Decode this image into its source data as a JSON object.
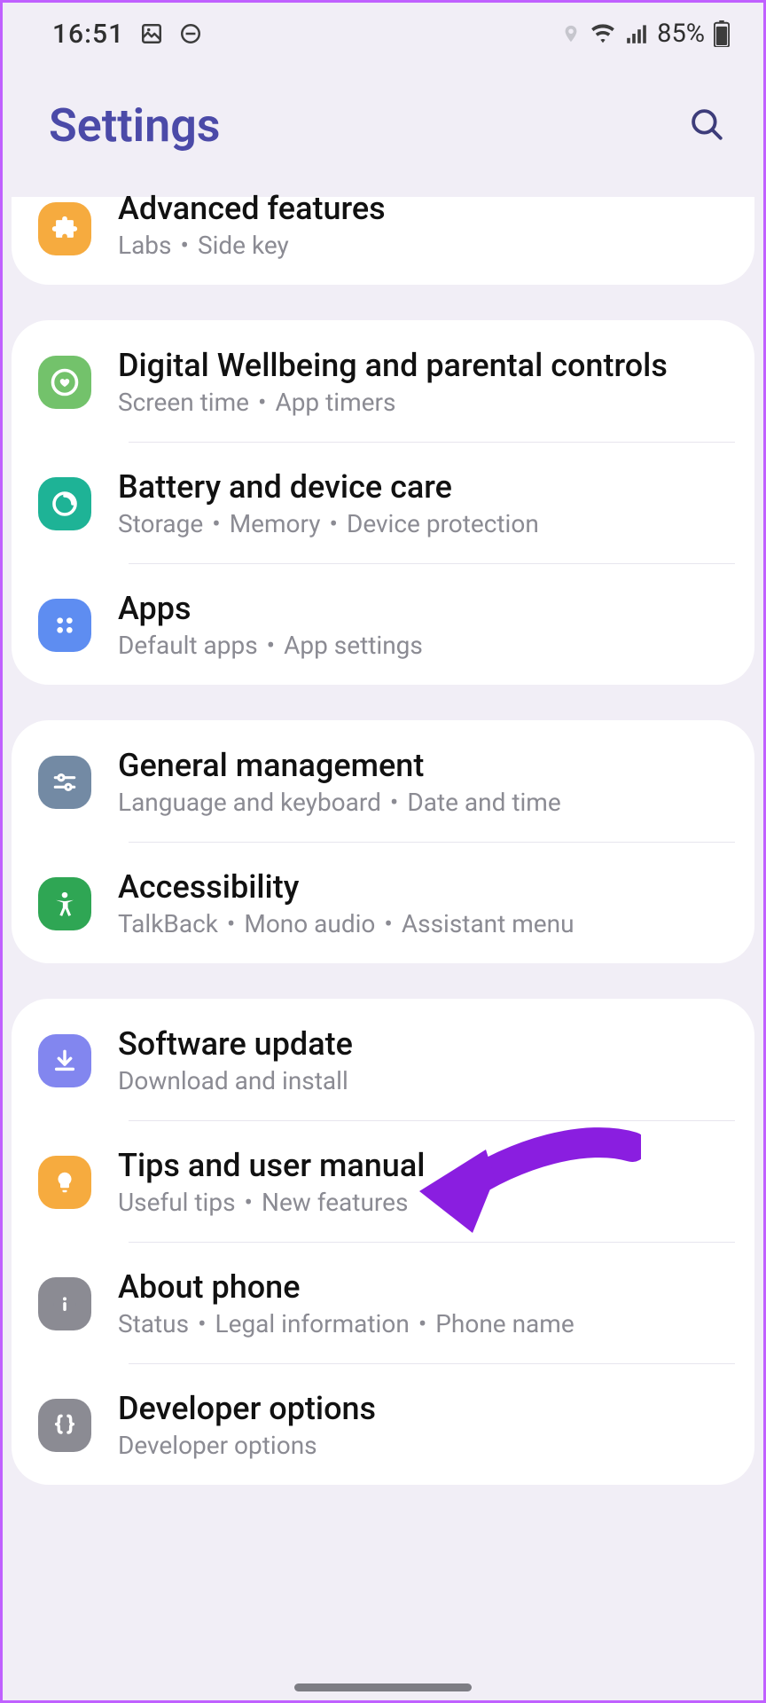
{
  "status": {
    "time": "16:51",
    "battery_text": "85%"
  },
  "header": {
    "title": "Settings"
  },
  "sections": [
    {
      "items": [
        {
          "id": "advanced-features",
          "title": "Advanced features",
          "subs": [
            "Labs",
            "Side key"
          ],
          "color": "#f6ab3f",
          "icon": "plus-puzzle"
        }
      ]
    },
    {
      "items": [
        {
          "id": "digital-wellbeing",
          "title": "Digital Wellbeing and parental controls",
          "subs": [
            "Screen time",
            "App timers"
          ],
          "color": "#73c26b",
          "icon": "heart-circle"
        },
        {
          "id": "battery-device-care",
          "title": "Battery and device care",
          "subs": [
            "Storage",
            "Memory",
            "Device protection"
          ],
          "color": "#1eb396",
          "icon": "refresh-circle"
        },
        {
          "id": "apps",
          "title": "Apps",
          "subs": [
            "Default apps",
            "App settings"
          ],
          "color": "#5e8df1",
          "icon": "apps-grid"
        }
      ]
    },
    {
      "items": [
        {
          "id": "general-management",
          "title": "General management",
          "subs": [
            "Language and keyboard",
            "Date and time"
          ],
          "color": "#738aa4",
          "icon": "sliders"
        },
        {
          "id": "accessibility",
          "title": "Accessibility",
          "subs": [
            "TalkBack",
            "Mono audio",
            "Assistant menu"
          ],
          "color": "#2fa654",
          "icon": "person"
        }
      ]
    },
    {
      "items": [
        {
          "id": "software-update",
          "title": "Software update",
          "subs": [
            "Download and install"
          ],
          "color": "#8286ef",
          "icon": "download-arrow"
        },
        {
          "id": "tips-manual",
          "title": "Tips and user manual",
          "subs": [
            "Useful tips",
            "New features"
          ],
          "color": "#f6ab3f",
          "icon": "bulb"
        },
        {
          "id": "about-phone",
          "title": "About phone",
          "subs": [
            "Status",
            "Legal information",
            "Phone name"
          ],
          "color": "#8b8b93",
          "icon": "info"
        },
        {
          "id": "developer-options",
          "title": "Developer options",
          "subs": [
            "Developer options"
          ],
          "color": "#8b8b93",
          "icon": "braces"
        }
      ]
    }
  ]
}
